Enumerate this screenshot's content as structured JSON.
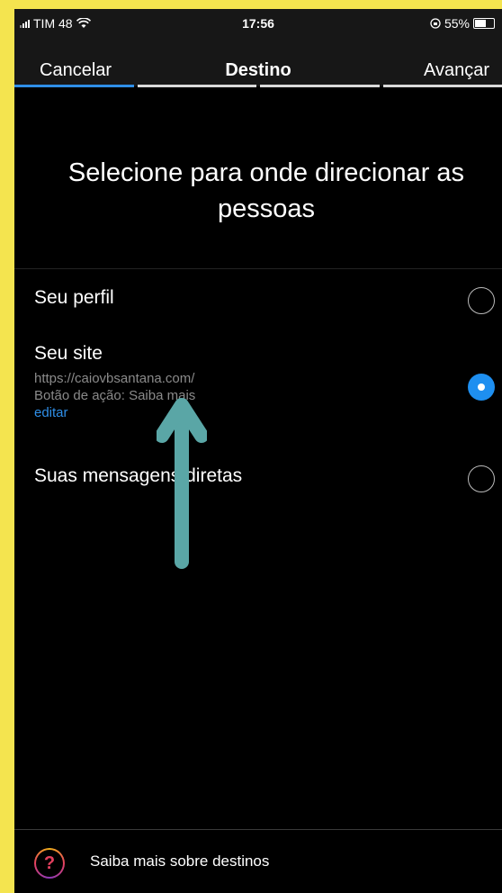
{
  "status_bar": {
    "carrier": "TIM 48",
    "time": "17:56",
    "battery": "55%"
  },
  "navbar": {
    "cancel_label": "Cancelar",
    "title": "Destino",
    "next_label": "Avançar"
  },
  "progress_steps": 4,
  "heading": "Selecione para onde direcionar as pessoas",
  "options": [
    {
      "label": "Seu perfil",
      "selected": false
    },
    {
      "label": "Seu site",
      "url": "https://caiovbsantana.com/",
      "cta": "Botão de ação: Saiba mais",
      "edit_label": "editar",
      "selected": true
    },
    {
      "label": "Suas mensagens diretas",
      "selected": false
    }
  ],
  "footer": {
    "help_text": "Saiba mais sobre destinos"
  },
  "colors": {
    "accent": "#1e8ff0",
    "background": "#000000",
    "frame": "#f4e44f",
    "arrow": "#5aa6a6"
  }
}
